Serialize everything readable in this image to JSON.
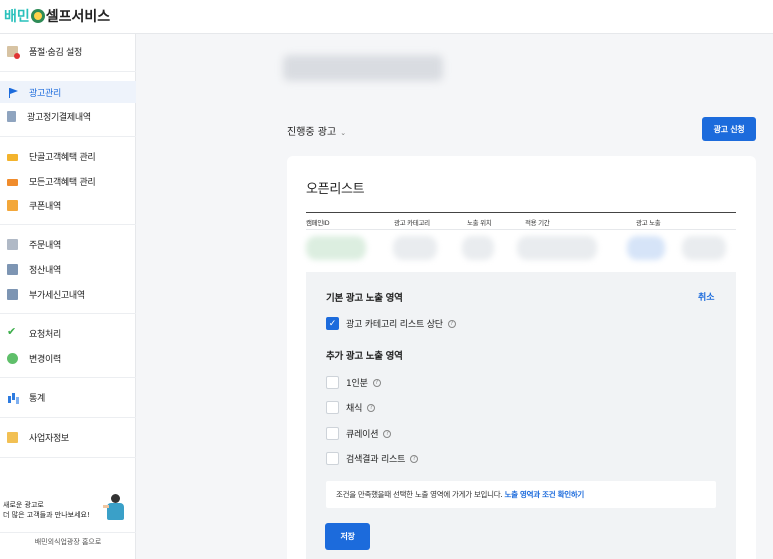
{
  "header": {
    "logo_left": "배민",
    "logo_right": "셀프서비스"
  },
  "sidebar": {
    "items": [
      {
        "label": "품절·숨김 설정",
        "icon": "folder-alert-icon"
      },
      {
        "label": "광고관리",
        "icon": "flag-icon",
        "active": true
      },
      {
        "label": "광고정기결제내역",
        "icon": "document-icon"
      },
      {
        "label": "단골고객혜택 관리",
        "icon": "coupon-icon"
      },
      {
        "label": "모든고객혜택 관리",
        "icon": "coupon-icon"
      },
      {
        "label": "쿠폰내역",
        "icon": "box-icon"
      },
      {
        "label": "주문내역",
        "icon": "clipboard-icon"
      },
      {
        "label": "정산내역",
        "icon": "calculator-icon"
      },
      {
        "label": "부가세신고내역",
        "icon": "calculator-icon"
      },
      {
        "label": "요청처리",
        "icon": "check-icon"
      },
      {
        "label": "변경이력",
        "icon": "refresh-icon"
      },
      {
        "label": "통계",
        "icon": "bar-chart-icon"
      },
      {
        "label": "사업자정보",
        "icon": "id-card-icon"
      }
    ],
    "promo_line1": "새로운 광고로",
    "promo_line2": "더 많은 고객들과 만나보세요!",
    "home_link": "배민외식업광장 홈으로"
  },
  "main": {
    "filter_label": "진행중 광고",
    "apply_button": "광고 신청",
    "card": {
      "title": "오픈리스트",
      "columns": [
        "캠페인ID",
        "광고 카테고리",
        "노출 위치",
        "적용 기간",
        "광고 노출"
      ],
      "panel": {
        "basic_title": "기본 광고 노출 영역",
        "cancel": "취소",
        "basic_option": {
          "label": "광고 카테고리 리스트 상단",
          "checked": true
        },
        "extra_title": "추가 광고 노출 영역",
        "extra_options": [
          {
            "label": "1인분",
            "checked": false
          },
          {
            "label": "채식",
            "checked": false
          },
          {
            "label": "큐레이션",
            "checked": false
          },
          {
            "label": "검색결과 리스트",
            "checked": false
          }
        ],
        "note_text": "조건을 만족했을때 선택한 노출 영역에 가게가 보입니다. ",
        "note_link": "노출 영역과 조건 확인하기",
        "save": "저장"
      }
    }
  },
  "colors": {
    "accent": "#1c6bdc",
    "brand": "#2ac1bc",
    "panel_bg": "#f1f3f5"
  }
}
